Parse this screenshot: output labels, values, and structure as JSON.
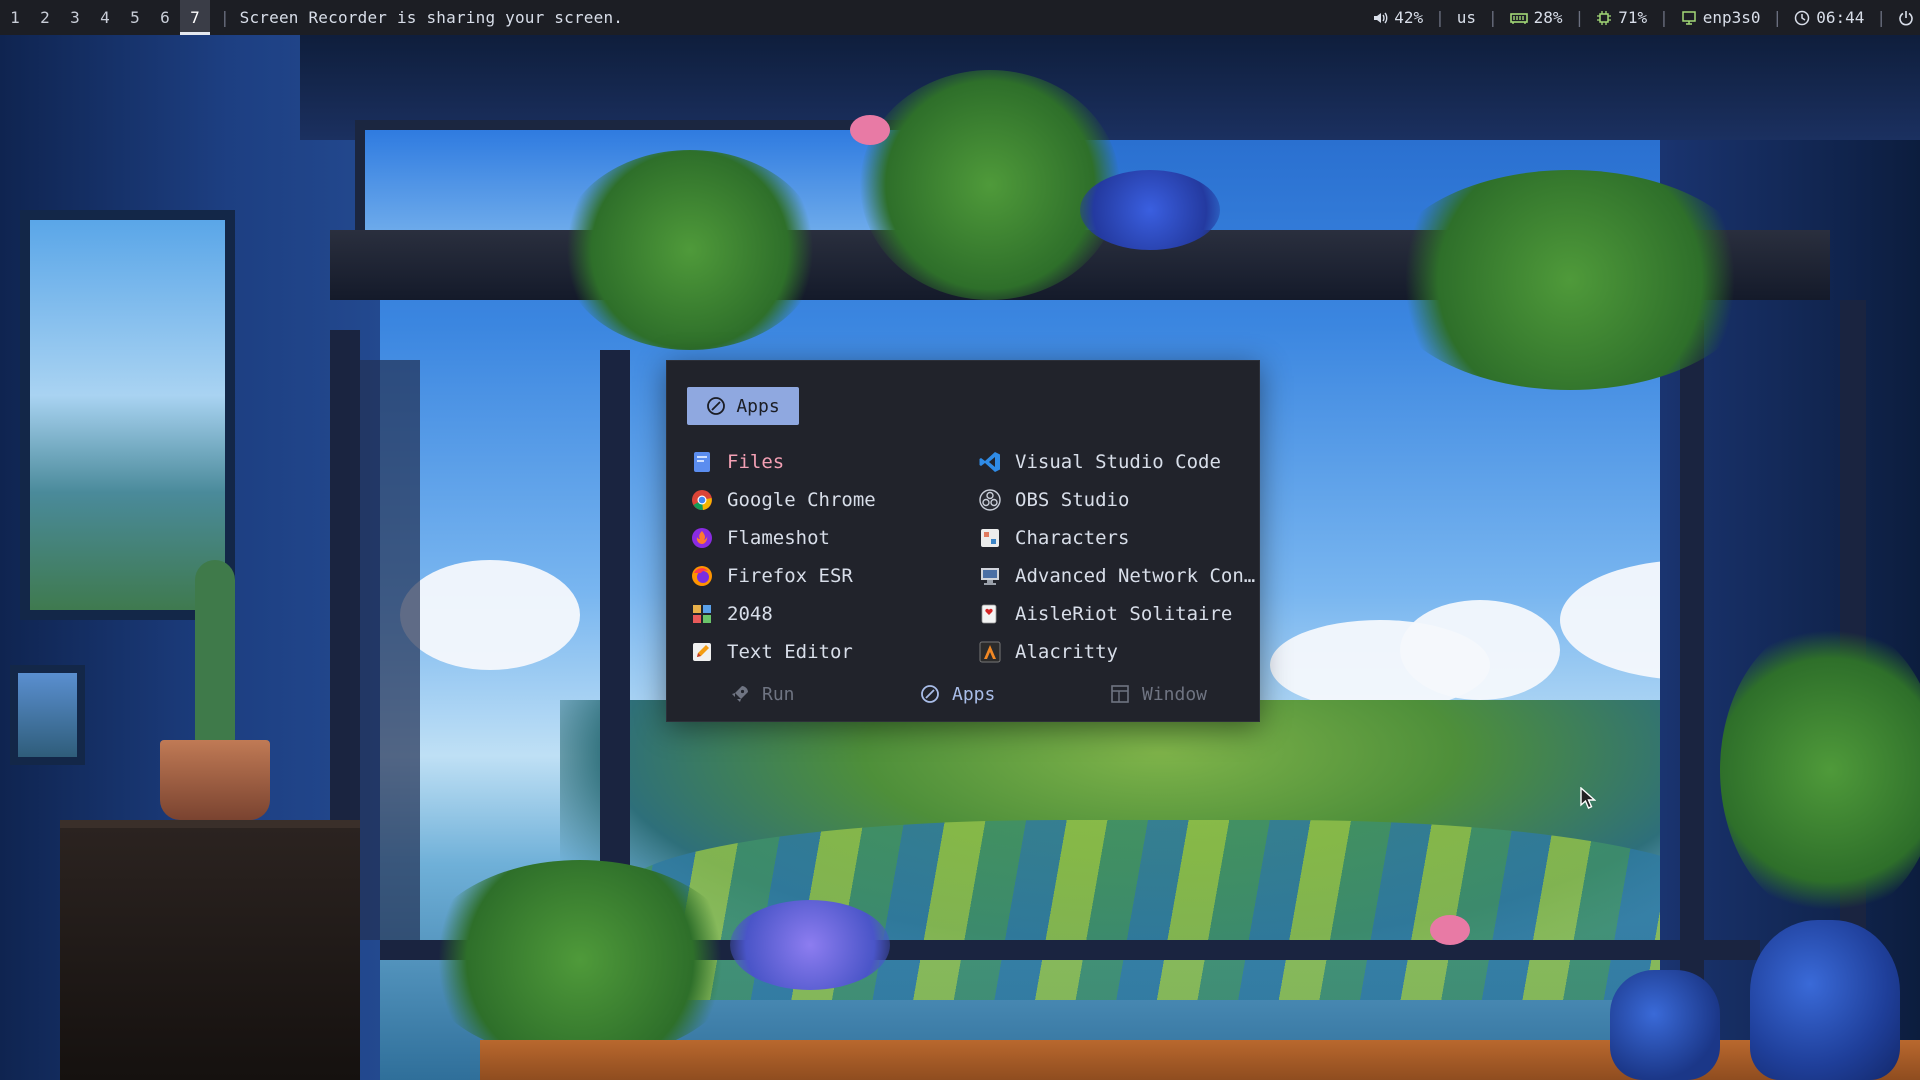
{
  "topbar": {
    "workspaces": [
      "1",
      "2",
      "3",
      "4",
      "5",
      "6",
      "7"
    ],
    "active_workspace": "7",
    "window_title": "Screen Recorder is sharing your screen.",
    "volume": "42%",
    "keyboard_layout": "us",
    "memory": "28%",
    "cpu": "71%",
    "network": "enp3s0",
    "clock": "06:44"
  },
  "launcher": {
    "mode_label": "Apps",
    "apps_left": [
      {
        "label": "Files",
        "icon": "files-icon"
      },
      {
        "label": "Google Chrome",
        "icon": "chrome-icon"
      },
      {
        "label": "Flameshot",
        "icon": "flameshot-icon"
      },
      {
        "label": "Firefox ESR",
        "icon": "firefox-icon"
      },
      {
        "label": "2048",
        "icon": "2048-icon"
      },
      {
        "label": "Text Editor",
        "icon": "text-editor-icon"
      }
    ],
    "apps_right": [
      {
        "label": "Visual Studio Code",
        "icon": "vscode-icon"
      },
      {
        "label": "OBS Studio",
        "icon": "obs-icon"
      },
      {
        "label": "Characters",
        "icon": "characters-icon"
      },
      {
        "label": "Advanced Network Con…",
        "icon": "network-connections-icon"
      },
      {
        "label": "AisleRiot Solitaire",
        "icon": "solitaire-icon"
      },
      {
        "label": "Alacritty",
        "icon": "alacritty-icon"
      }
    ],
    "selected": "Files",
    "footer_tabs": [
      {
        "label": "Run",
        "icon": "rocket-icon",
        "active": false
      },
      {
        "label": "Apps",
        "icon": "apps-icon",
        "active": true
      },
      {
        "label": "Window",
        "icon": "window-icon",
        "active": false
      }
    ]
  },
  "colors": {
    "bar_bg": "#1c1e24",
    "menu_bg": "#21232b",
    "accent": "#8fa8e0",
    "selected_text": "#f3a0b4",
    "text": "#d8dee9",
    "dim_text": "#6f7482"
  }
}
